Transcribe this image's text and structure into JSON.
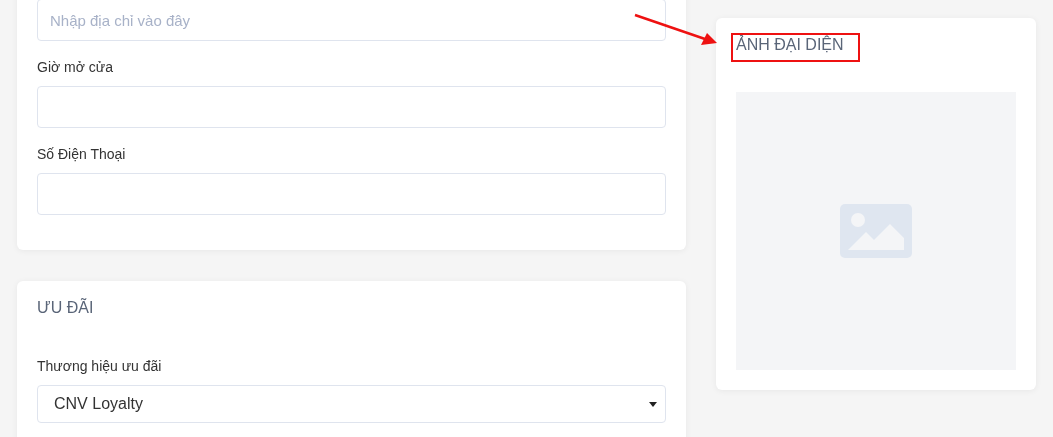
{
  "address_field": {
    "placeholder": "Nhập địa chỉ vào đây"
  },
  "fields": [
    {
      "label": "Giờ mở cửa"
    },
    {
      "label": "Số Điện Thoại"
    }
  ],
  "offers": {
    "title": "ƯU ĐÃI",
    "brand": {
      "label": "Thương hiệu ưu đãi",
      "value": "CNV Loyalty"
    }
  },
  "avatar": {
    "title": "ẢNH ĐẠI DIỆN",
    "highlighted": true
  }
}
